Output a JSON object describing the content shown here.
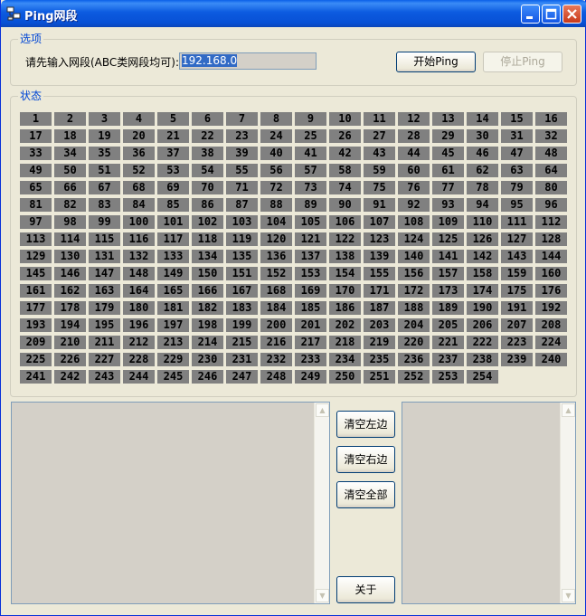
{
  "window": {
    "title": "Ping网段"
  },
  "options": {
    "group_title": "选项",
    "prompt_label": "请先输入网段(ABC类网段均可):",
    "ip_value": "192.168.0",
    "start_button": "开始Ping",
    "stop_button": "停止Ping"
  },
  "status": {
    "group_title": "状态",
    "cells": [
      "1",
      "2",
      "3",
      "4",
      "5",
      "6",
      "7",
      "8",
      "9",
      "10",
      "11",
      "12",
      "13",
      "14",
      "15",
      "16",
      "17",
      "18",
      "19",
      "20",
      "21",
      "22",
      "23",
      "24",
      "25",
      "26",
      "27",
      "28",
      "29",
      "30",
      "31",
      "32",
      "33",
      "34",
      "35",
      "36",
      "37",
      "38",
      "39",
      "40",
      "41",
      "42",
      "43",
      "44",
      "45",
      "46",
      "47",
      "48",
      "49",
      "50",
      "51",
      "52",
      "53",
      "54",
      "55",
      "56",
      "57",
      "58",
      "59",
      "60",
      "61",
      "62",
      "63",
      "64",
      "65",
      "66",
      "67",
      "68",
      "69",
      "70",
      "71",
      "72",
      "73",
      "74",
      "75",
      "76",
      "77",
      "78",
      "79",
      "80",
      "81",
      "82",
      "83",
      "84",
      "85",
      "86",
      "87",
      "88",
      "89",
      "90",
      "91",
      "92",
      "93",
      "94",
      "95",
      "96",
      "97",
      "98",
      "99",
      "100",
      "101",
      "102",
      "103",
      "104",
      "105",
      "106",
      "107",
      "108",
      "109",
      "110",
      "111",
      "112",
      "113",
      "114",
      "115",
      "116",
      "117",
      "118",
      "119",
      "120",
      "121",
      "122",
      "123",
      "124",
      "125",
      "126",
      "127",
      "128",
      "129",
      "130",
      "131",
      "132",
      "133",
      "134",
      "135",
      "136",
      "137",
      "138",
      "139",
      "140",
      "141",
      "142",
      "143",
      "144",
      "145",
      "146",
      "147",
      "148",
      "149",
      "150",
      "151",
      "152",
      "153",
      "154",
      "155",
      "156",
      "157",
      "158",
      "159",
      "160",
      "161",
      "162",
      "163",
      "164",
      "165",
      "166",
      "167",
      "168",
      "169",
      "170",
      "171",
      "172",
      "173",
      "174",
      "175",
      "176",
      "177",
      "178",
      "179",
      "180",
      "181",
      "182",
      "183",
      "184",
      "185",
      "186",
      "187",
      "188",
      "189",
      "190",
      "191",
      "192",
      "193",
      "194",
      "195",
      "196",
      "197",
      "198",
      "199",
      "200",
      "201",
      "202",
      "203",
      "204",
      "205",
      "206",
      "207",
      "208",
      "209",
      "210",
      "211",
      "212",
      "213",
      "214",
      "215",
      "216",
      "217",
      "218",
      "219",
      "220",
      "221",
      "222",
      "223",
      "224",
      "225",
      "226",
      "227",
      "228",
      "229",
      "230",
      "231",
      "232",
      "233",
      "234",
      "235",
      "236",
      "237",
      "238",
      "239",
      "240",
      "241",
      "242",
      "243",
      "244",
      "245",
      "246",
      "247",
      "248",
      "249",
      "250",
      "251",
      "252",
      "253",
      "254"
    ]
  },
  "actions": {
    "clear_left": "清空左边",
    "clear_right": "清空右边",
    "clear_all": "清空全部",
    "about": "关于"
  },
  "colors": {
    "cell_bg": "#808080",
    "group_title": "#0046d5",
    "titlebar": "#0a5fe8"
  },
  "icons": [
    "network-app-icon",
    "minimize-icon",
    "maximize-icon",
    "close-icon",
    "scroll-up-icon",
    "scroll-down-icon"
  ]
}
